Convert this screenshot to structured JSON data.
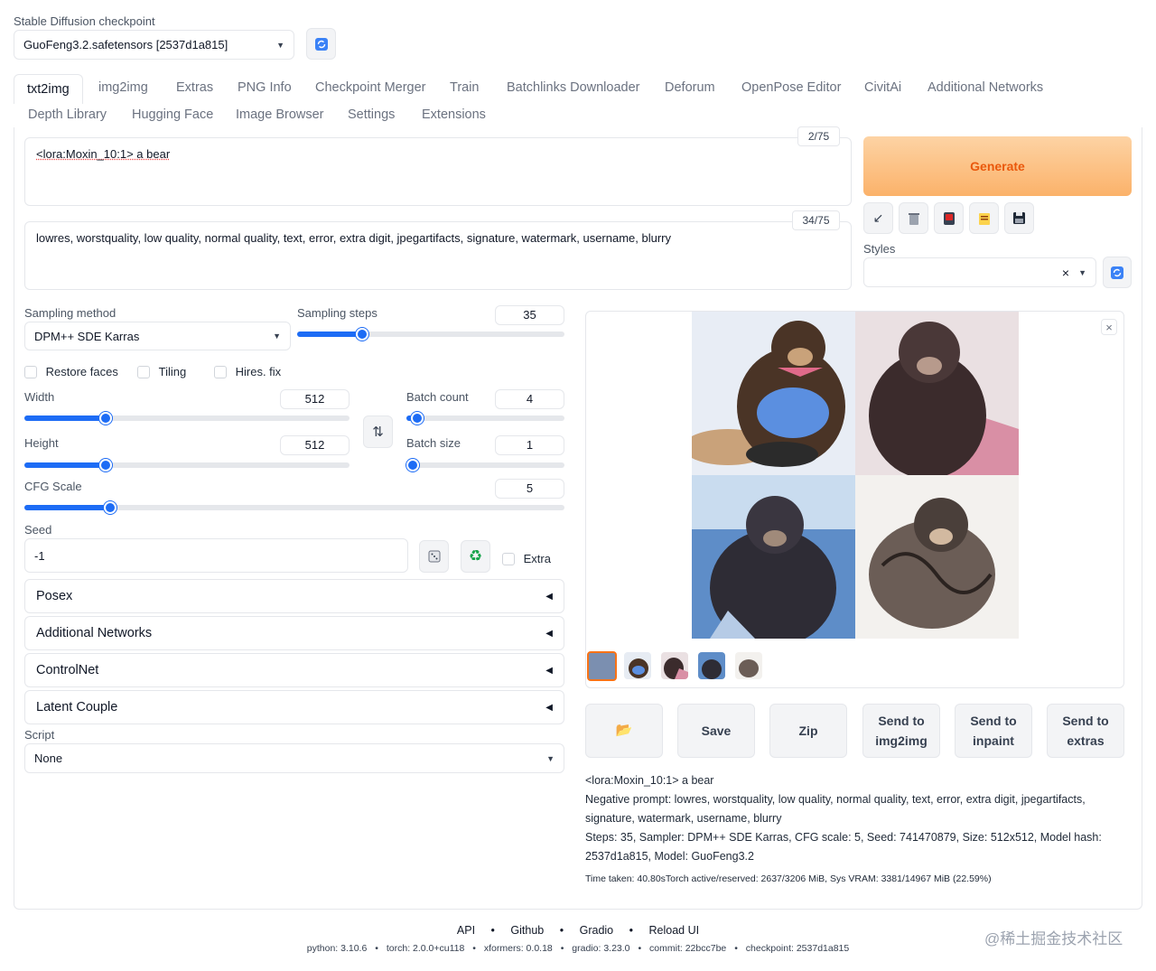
{
  "checkpoint": {
    "label": "Stable Diffusion checkpoint",
    "value": "GuoFeng3.2.safetensors [2537d1a815]"
  },
  "tabs_row1": [
    "txt2img",
    "img2img",
    "Extras",
    "PNG Info",
    "Checkpoint Merger",
    "Train",
    "Batchlinks Downloader",
    "Deforum",
    "OpenPose Editor",
    "CivitAi",
    "Additional Networks"
  ],
  "tabs_row2": [
    "Depth Library",
    "Hugging Face",
    "Image Browser",
    "Settings",
    "Extensions"
  ],
  "prompt": {
    "positive": "<lora:Moxin_10:1> a bear",
    "positive_count": "2/75",
    "negative": "lowres, worstquality, low quality, normal quality, text, error, extra digit, jpegartifacts, signature, watermark, username, blurry",
    "negative_count": "34/75"
  },
  "generate_label": "Generate",
  "styles_label": "Styles",
  "style_clear": "×",
  "sampling": {
    "method_label": "Sampling method",
    "method_value": "DPM++ SDE Karras",
    "steps_label": "Sampling steps",
    "steps_value": "35",
    "steps_fraction": 0.23
  },
  "checkboxes": {
    "restore_faces": "Restore faces",
    "tiling": "Tiling",
    "hires_fix": "Hires. fix"
  },
  "width": {
    "label": "Width",
    "value": "512",
    "fraction": 0.24
  },
  "height": {
    "label": "Height",
    "value": "512",
    "fraction": 0.24
  },
  "batch_count": {
    "label": "Batch count",
    "value": "4",
    "fraction": 0.03
  },
  "batch_size": {
    "label": "Batch size",
    "value": "1",
    "fraction": 0.0
  },
  "cfg": {
    "label": "CFG Scale",
    "value": "5",
    "fraction": 0.15
  },
  "seed": {
    "label": "Seed",
    "value": "-1",
    "extra_label": "Extra"
  },
  "accordions": [
    "Posex",
    "Additional Networks",
    "ControlNet",
    "Latent Couple"
  ],
  "script": {
    "label": "Script",
    "value": "None"
  },
  "gallery_close": "×",
  "actions": {
    "save": "Save",
    "zip": "Zip",
    "send_img2img": "Send to img2img",
    "send_inpaint": "Send to inpaint",
    "send_extras": "Send to extras"
  },
  "output": {
    "prompt": "<lora:Moxin_10:1> a bear",
    "negative": "Negative prompt: lowres, worstquality, low quality, normal quality, text, error, extra digit, jpegartifacts, signature, watermark, username, blurry",
    "params": "Steps: 35, Sampler: DPM++ SDE Karras, CFG scale: 5, Seed: 741470879, Size: 512x512, Model hash: 2537d1a815, Model: GuoFeng3.2",
    "time": "Time taken: 40.80sTorch active/reserved: 2637/3206 MiB, Sys VRAM: 3381/14967 MiB (22.59%)"
  },
  "footer": {
    "links": [
      "API",
      "Github",
      "Gradio",
      "Reload UI"
    ],
    "sep": "•",
    "versions": [
      "python: 3.10.6",
      "torch: 2.0.0+cu118",
      "xformers: 0.0.18",
      "gradio: 3.23.0",
      "commit: 22bcc7be",
      "checkpoint: 2537d1a815"
    ]
  },
  "watermark": "@稀土掘金技术社区",
  "colors": {
    "accent": "#1d6cf5",
    "generate_bg": "#fbbf77",
    "generate_text": "#ea580c"
  }
}
